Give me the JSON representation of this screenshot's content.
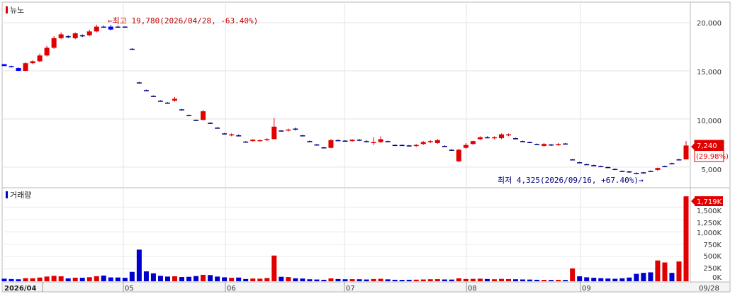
{
  "chart_data": {
    "type": "candlestick",
    "price_panel": {
      "title": "뉴노",
      "y_ticks": [
        "20,000",
        "15,000",
        "10,000",
        "5,000"
      ],
      "ylim": [
        3000,
        22000
      ],
      "annotations": {
        "high": "←최고 19,780(2026/04/28, -63.40%)",
        "low": "최저 4,325(2026/09/16, +67.40%)→"
      },
      "last_price_tag": {
        "price": "7,240",
        "change": "(29.98%)"
      }
    },
    "volume_panel": {
      "title": "거래량",
      "y_ticks": [
        "1,500K",
        "1,250K",
        "1,000K",
        "750K",
        "500K",
        "250K",
        "0K"
      ],
      "ylim": [
        0,
        1850
      ],
      "last_volume_tag": "1,719K"
    },
    "x_labels": [
      "2026/04",
      "05",
      "06",
      "07",
      "08",
      "09",
      "09/28"
    ],
    "candles": [
      [
        15700,
        15700,
        15500,
        15500,
        52
      ],
      [
        15500,
        15550,
        15350,
        15400,
        45
      ],
      [
        15300,
        15350,
        15000,
        15000,
        40
      ],
      [
        15000,
        15900,
        15000,
        15800,
        62
      ],
      [
        15800,
        16100,
        15700,
        16000,
        60
      ],
      [
        16000,
        16800,
        15900,
        16600,
        75
      ],
      [
        16600,
        17600,
        16500,
        17400,
        95
      ],
      [
        17400,
        18600,
        17300,
        18400,
        110
      ],
      [
        18400,
        19000,
        18300,
        18800,
        100
      ],
      [
        18600,
        18700,
        18400,
        18600,
        58
      ],
      [
        18400,
        19000,
        18300,
        18900,
        72
      ],
      [
        18700,
        18800,
        18500,
        18700,
        70
      ],
      [
        18700,
        19300,
        18600,
        19100,
        82
      ],
      [
        19100,
        19800,
        19000,
        19600,
        102
      ],
      [
        19600,
        19700,
        19500,
        19600,
        115
      ],
      [
        19600,
        19780,
        19200,
        19300,
        78
      ],
      [
        19600,
        19700,
        19500,
        19600,
        76
      ],
      [
        19600,
        19650,
        19500,
        19550,
        70
      ],
      [
        17300,
        17350,
        17200,
        17250,
        190
      ],
      [
        13800,
        13850,
        13700,
        13750,
        640
      ],
      [
        13000,
        13050,
        12900,
        13000,
        200
      ],
      [
        12400,
        12450,
        12300,
        12350,
        160
      ],
      [
        11900,
        11950,
        11800,
        11850,
        110
      ],
      [
        11700,
        11750,
        11600,
        11650,
        95
      ],
      [
        11900,
        12300,
        11800,
        12100,
        100
      ],
      [
        11000,
        11050,
        10900,
        10950,
        85
      ],
      [
        10400,
        10450,
        10300,
        10350,
        90
      ],
      [
        9900,
        9950,
        9800,
        9850,
        105
      ],
      [
        9900,
        10950,
        9850,
        10800,
        130
      ],
      [
        9600,
        9650,
        9500,
        9550,
        125
      ],
      [
        9100,
        9150,
        9000,
        9050,
        95
      ],
      [
        8500,
        8550,
        8400,
        8450,
        80
      ],
      [
        8300,
        8500,
        8200,
        8400,
        70
      ],
      [
        8300,
        8400,
        8200,
        8300,
        75
      ],
      [
        7650,
        7700,
        7600,
        7650,
        45
      ],
      [
        7700,
        7900,
        7650,
        7850,
        55
      ],
      [
        7700,
        7850,
        7650,
        7800,
        52
      ],
      [
        7800,
        8000,
        7700,
        7900,
        65
      ],
      [
        7900,
        10100,
        7900,
        9200,
        520
      ],
      [
        8800,
        8850,
        8700,
        8750,
        90
      ],
      [
        8800,
        9000,
        8700,
        8900,
        85
      ],
      [
        9000,
        9100,
        8800,
        8950,
        60
      ],
      [
        8300,
        8350,
        8200,
        8250,
        55
      ],
      [
        7700,
        7750,
        7600,
        7650,
        40
      ],
      [
        7350,
        7400,
        7250,
        7300,
        35
      ],
      [
        7050,
        7100,
        6950,
        7000,
        30
      ],
      [
        7000,
        7900,
        6950,
        7800,
        58
      ],
      [
        7800,
        7850,
        7700,
        7750,
        45
      ],
      [
        7750,
        7800,
        7650,
        7700,
        40
      ],
      [
        7700,
        7900,
        7650,
        7850,
        42
      ],
      [
        7800,
        7900,
        7700,
        7850,
        40
      ],
      [
        7700,
        7800,
        7600,
        7700,
        35
      ],
      [
        7500,
        8100,
        7300,
        7600,
        45
      ],
      [
        7600,
        8200,
        7500,
        7900,
        50
      ],
      [
        7700,
        7750,
        7600,
        7650,
        38
      ],
      [
        7300,
        7350,
        7200,
        7250,
        30
      ],
      [
        7300,
        7350,
        7200,
        7300,
        28
      ],
      [
        7250,
        7300,
        7150,
        7200,
        30
      ],
      [
        7200,
        7400,
        7100,
        7300,
        32
      ],
      [
        7400,
        7700,
        7300,
        7600,
        36
      ],
      [
        7600,
        7800,
        7500,
        7700,
        40
      ],
      [
        7500,
        7900,
        7400,
        7800,
        42
      ],
      [
        7200,
        7250,
        7100,
        7150,
        36
      ],
      [
        6800,
        6850,
        6700,
        6750,
        34
      ],
      [
        5600,
        6900,
        5500,
        6800,
        60
      ],
      [
        7000,
        7500,
        6900,
        7300,
        46
      ],
      [
        7400,
        7750,
        7300,
        7700,
        48
      ],
      [
        7900,
        8200,
        7800,
        8100,
        52
      ],
      [
        8100,
        8200,
        8000,
        8100,
        45
      ],
      [
        8000,
        8200,
        7900,
        8100,
        40
      ],
      [
        8000,
        8500,
        7900,
        8400,
        48
      ],
      [
        8300,
        8500,
        8200,
        8400,
        44
      ],
      [
        8000,
        8050,
        7900,
        7950,
        40
      ],
      [
        7700,
        7750,
        7600,
        7650,
        36
      ],
      [
        7600,
        7650,
        7500,
        7550,
        34
      ],
      [
        7400,
        7450,
        7300,
        7350,
        30
      ],
      [
        7200,
        7500,
        7100,
        7400,
        28
      ],
      [
        7300,
        7400,
        7200,
        7350,
        26
      ],
      [
        7300,
        7500,
        7200,
        7400,
        28
      ],
      [
        7450,
        7500,
        7350,
        7400,
        26
      ],
      [
        5800,
        5850,
        5750,
        5800,
        260
      ],
      [
        5500,
        5550,
        5450,
        5500,
        100
      ],
      [
        5300,
        5350,
        5250,
        5300,
        80
      ],
      [
        5200,
        5250,
        5150,
        5200,
        70
      ],
      [
        5100,
        5150,
        5050,
        5100,
        62
      ],
      [
        5000,
        5050,
        4950,
        5000,
        55
      ],
      [
        4800,
        4850,
        4750,
        4800,
        50
      ],
      [
        4600,
        4650,
        4550,
        4600,
        60
      ],
      [
        4500,
        4600,
        4400,
        4550,
        75
      ],
      [
        4400,
        4450,
        4325,
        4400,
        150
      ],
      [
        4400,
        4500,
        4350,
        4450,
        170
      ],
      [
        4600,
        4650,
        4550,
        4600,
        180
      ],
      [
        4700,
        4950,
        4600,
        4900,
        420
      ],
      [
        5100,
        5150,
        5050,
        5100,
        380
      ],
      [
        5400,
        5450,
        5350,
        5400,
        170
      ],
      [
        5800,
        5850,
        5750,
        5800,
        400
      ],
      [
        5800,
        7700,
        5800,
        7240,
        1719
      ]
    ]
  }
}
